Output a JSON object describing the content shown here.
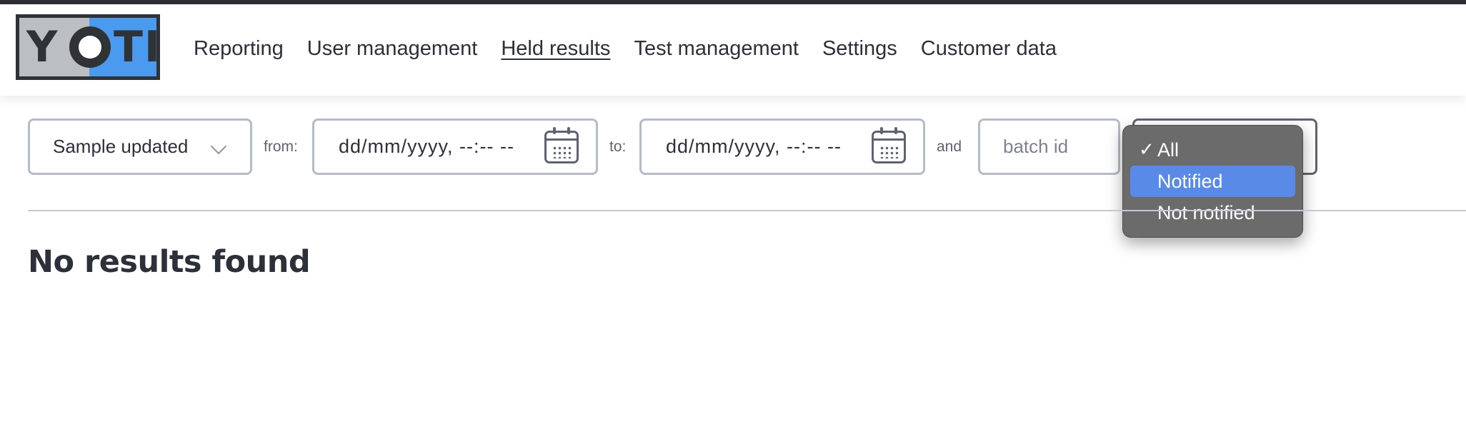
{
  "logo": {
    "text_y": "Y",
    "text_ti": "TI"
  },
  "nav": [
    {
      "label": "Reporting",
      "active": false
    },
    {
      "label": "User management",
      "active": false
    },
    {
      "label": "Held results",
      "active": true
    },
    {
      "label": "Test management",
      "active": false
    },
    {
      "label": "Settings",
      "active": false
    },
    {
      "label": "Customer data",
      "active": false
    }
  ],
  "filters": {
    "date_type": {
      "value": "Sample updated",
      "icon": "chevron-down-icon"
    },
    "from_label": "from:",
    "from_date": {
      "value": "dd/mm/yyyy, --:-- --",
      "icon": "calendar-icon"
    },
    "to_label": "to:",
    "to_date": {
      "value": "dd/mm/yyyy, --:-- --",
      "icon": "calendar-icon"
    },
    "and_label": "and",
    "batch": {
      "placeholder": "batch id",
      "value": ""
    },
    "status": {
      "options": [
        {
          "label": "All",
          "checked": true,
          "highlighted": false
        },
        {
          "label": "Notified",
          "checked": false,
          "highlighted": true
        },
        {
          "label": "Not notified",
          "checked": false,
          "highlighted": false
        }
      ]
    }
  },
  "results": {
    "message": "No results found"
  },
  "colors": {
    "text": "#2c3039",
    "logo_blue": "#4a9af0",
    "logo_grey": "#bcbfc1",
    "dropdown_bg": "#6b6b6b",
    "dropdown_highlight": "#5a8ae8"
  }
}
